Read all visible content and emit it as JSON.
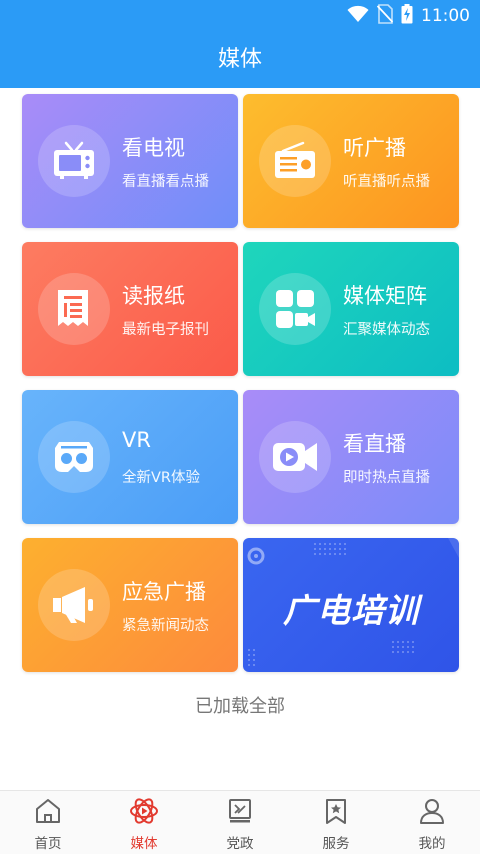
{
  "status_bar": {
    "time": "11:00",
    "icons": [
      "wifi-icon",
      "no-sim-icon",
      "battery-charging-icon"
    ]
  },
  "header": {
    "title": "媒体"
  },
  "cards": [
    {
      "title": "看电视",
      "subtitle": "看直播看点播",
      "icon": "tv-icon",
      "colors": [
        "#a98cf8",
        "#6f8ef9"
      ]
    },
    {
      "title": "听广播",
      "subtitle": "听直播听点播",
      "icon": "radio-icon",
      "colors": [
        "#fdbd2e",
        "#fd9420"
      ]
    },
    {
      "title": "读报纸",
      "subtitle": "最新电子报刊",
      "icon": "newspaper-icon",
      "colors": [
        "#fd7c61",
        "#fb5a49"
      ]
    },
    {
      "title": "媒体矩阵",
      "subtitle": "汇聚媒体动态",
      "icon": "media-matrix-icon",
      "colors": [
        "#1fd6bc",
        "#0dbdc3"
      ]
    },
    {
      "title": "VR",
      "subtitle": "全新VR体验",
      "icon": "vr-goggles-icon",
      "colors": [
        "#68b4fb",
        "#4a9df7"
      ]
    },
    {
      "title": "看直播",
      "subtitle": "即时热点直播",
      "icon": "live-video-icon",
      "colors": [
        "#a98cf8",
        "#7b8cf9"
      ]
    },
    {
      "title": "应急广播",
      "subtitle": "紧急新闻动态",
      "icon": "megaphone-icon",
      "colors": [
        "#fdb02f",
        "#fd8a3c"
      ]
    },
    {
      "banner_text": "广电培训",
      "icon": "training-banner",
      "colors": [
        "#3a66f0",
        "#2f54e8"
      ]
    }
  ],
  "footer_text": "已加载全部",
  "tabbar": {
    "items": [
      {
        "label": "首页",
        "icon": "home-icon",
        "active": false
      },
      {
        "label": "媒体",
        "icon": "media-atom-icon",
        "active": true
      },
      {
        "label": "党政",
        "icon": "party-icon",
        "active": false
      },
      {
        "label": "服务",
        "icon": "service-bookmark-icon",
        "active": false
      },
      {
        "label": "我的",
        "icon": "profile-icon",
        "active": false
      }
    ],
    "active_color": "#e23a2f",
    "inactive_color": "#555555"
  },
  "accent": "#2b9bf6"
}
